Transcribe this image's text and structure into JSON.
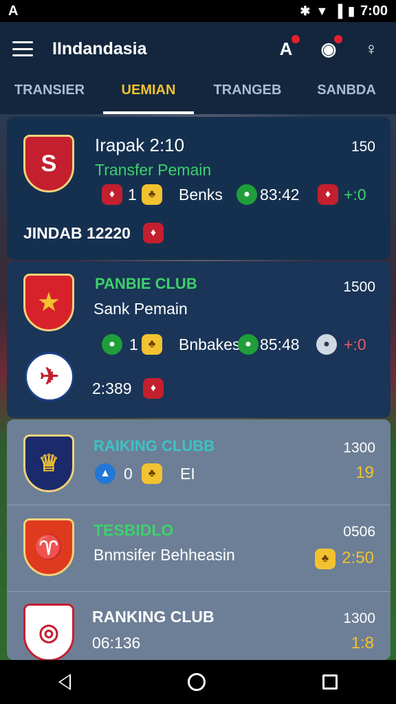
{
  "status": {
    "left_icon": "A",
    "time": "7:00"
  },
  "appbar": {
    "title": "IIndandasia"
  },
  "tabs": [
    "TRANSIER",
    "UEMIAN",
    "TRANGEB",
    "SANBDA"
  ],
  "cards": [
    {
      "title": "Irapak 2:10",
      "value": "150",
      "subtitle": "Transfer Pemain",
      "stat_a": "1",
      "stat_label": "Benks",
      "stat_b": "83:42",
      "stat_c": "+:0",
      "footer": "JINDAB 12220"
    },
    {
      "title": "PANBIE CLUB",
      "value": "1500",
      "subtitle": "Sank Pemain",
      "stat_a": "1",
      "stat_label": "Bnbakes",
      "stat_b": "85:48",
      "stat_c": "+:0",
      "footer": "2:389"
    },
    {
      "title": "RAIKING CLUBB",
      "value": "1300",
      "stat_a": "0",
      "stat_label": "EI",
      "stat_c": "19"
    },
    {
      "title": "TESBIDLO",
      "value": "0506",
      "subtitle": "Bnmsifer Behheasin",
      "stat_c": "2:50"
    },
    {
      "title": "RANKING CLUB",
      "value": "1300",
      "subtitle": "06:136",
      "stat_c": "1:8"
    }
  ],
  "colors": {
    "accent": "#f2c230",
    "green": "#3dd16b",
    "teal": "#3cc3c6",
    "bar": "#13263d"
  }
}
